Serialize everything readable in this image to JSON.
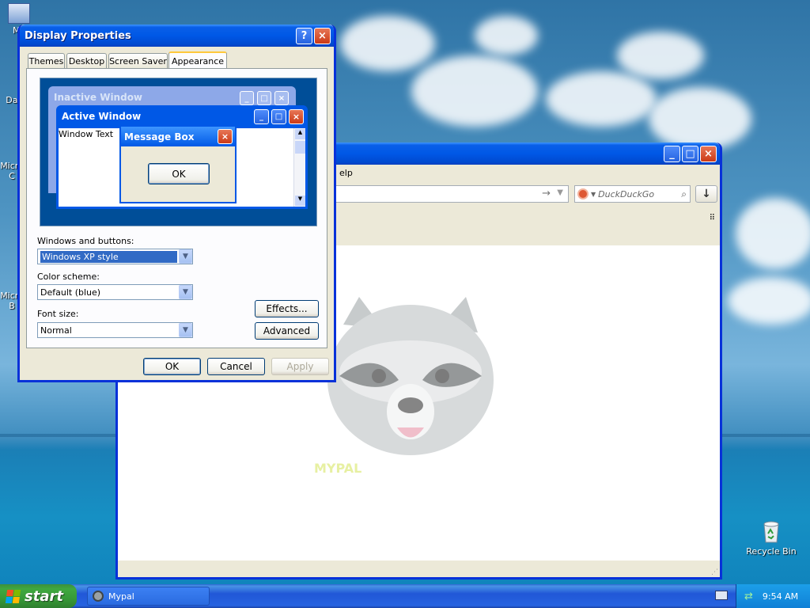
{
  "desktop": {
    "icons_left": [
      "My",
      "Dat",
      "Micro",
      "Micro"
    ],
    "icons_left_sub": [
      "",
      "",
      "C",
      "B"
    ],
    "recycle_bin": "Recycle Bin"
  },
  "browser": {
    "menu_fragment": "elp",
    "search_placeholder": "DuckDuckGo",
    "watermark": "MYPAL"
  },
  "display_properties": {
    "title": "Display Properties",
    "help_btn": "?",
    "close_btn": "×",
    "tabs": [
      "Themes",
      "Desktop",
      "Screen Saver",
      "Appearance"
    ],
    "preview": {
      "inactive_title": "Inactive Window",
      "active_title": "Active Window",
      "window_text": "Window Text",
      "msgbox_title": "Message Box",
      "msgbox_ok": "OK"
    },
    "windows_buttons_label": "Windows and buttons:",
    "windows_buttons_value": "Windows XP style",
    "color_scheme_label": "Color scheme:",
    "color_scheme_value": "Default (blue)",
    "font_size_label": "Font size:",
    "font_size_value": "Normal",
    "effects_btn": "Effects...",
    "advanced_btn": "Advanced",
    "ok_btn": "OK",
    "cancel_btn": "Cancel",
    "apply_btn": "Apply"
  },
  "taskbar": {
    "start": "start",
    "task_label": "Mypal",
    "clock": "9:54 AM"
  },
  "colors": {
    "xp_blue": "#0058e6",
    "xp_face": "#ece9d8",
    "start_green": "#3fa83f",
    "close_red": "#cc3a16"
  }
}
